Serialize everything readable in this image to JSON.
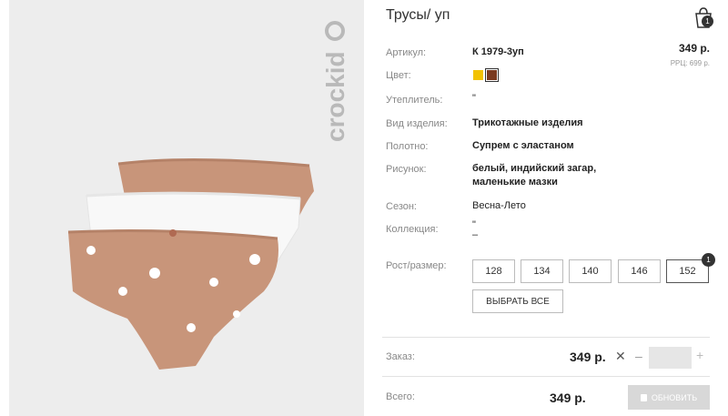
{
  "product": {
    "title": "Трусы/ уп",
    "price": "349 р.",
    "rrp": "РРЦ: 699 р.",
    "brand_logo": "crockid"
  },
  "cart": {
    "icon": "shopping-bag-icon",
    "count": "1"
  },
  "details": [
    {
      "label": "Артикул:",
      "value": "К 1979-3уп"
    },
    {
      "label": "Цвет:",
      "value": ""
    },
    {
      "label": "Утеплитель:",
      "value": "\""
    },
    {
      "label": "Вид изделия:",
      "value": "Трикотажные изделия"
    },
    {
      "label": "Полотно:",
      "value": "Супрем с эластаном"
    },
    {
      "label": "Рисунок:",
      "value": "белый, индийский загар, маленькие мазки"
    },
    {
      "label": "Сезон:",
      "value": "Весна-Лето"
    },
    {
      "label": "Коллекция:",
      "value": "\"\n–"
    }
  ],
  "colors": [
    {
      "name": "yellow",
      "hex": "#f2c200"
    },
    {
      "name": "brown",
      "hex": "#7a3a20",
      "selected": true
    }
  ],
  "sizes": {
    "label": "Рост/размер:",
    "options": [
      "128",
      "134",
      "140",
      "146",
      "152"
    ],
    "selected": "152",
    "selected_count": "1",
    "select_all": "ВЫБРАТЬ ВСЕ"
  },
  "order": {
    "label": "Заказ:",
    "price": "349 р.",
    "x": "✕",
    "minus": "–",
    "plus": "+",
    "quantity": ""
  },
  "total": {
    "label": "Всего:",
    "price": "349 р.",
    "update": "ОБНОВИТЬ"
  }
}
